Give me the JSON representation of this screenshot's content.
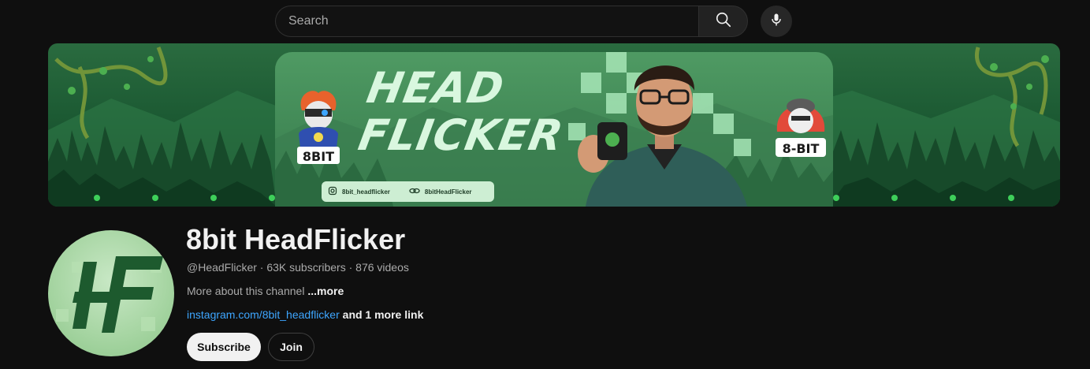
{
  "search": {
    "placeholder": "Search"
  },
  "icons": {
    "search": "search-icon",
    "mic": "microphone-icon",
    "instagram": "instagram-icon",
    "link": "link-icon"
  },
  "banner": {
    "title_line1": "HEAD",
    "title_line2": "FLICKER",
    "instagram_handle": "8bit_headflicker",
    "link_handle": "8bitHeadFlicker",
    "logo_left_text": "8BIT",
    "logo_right_text": "8-BIT"
  },
  "avatar": {
    "initials": "HF"
  },
  "channel": {
    "name": "8bit HeadFlicker",
    "handle": "@HeadFlicker",
    "subscribers": "63K subscribers",
    "videos": "876 videos",
    "meta_line": "@HeadFlicker · 63K subscribers · 876 videos",
    "about_text": "More about this channel ",
    "about_more": "...more",
    "link_text": "instagram.com/8bit_headflicker",
    "link_extra": " and 1 more link"
  },
  "buttons": {
    "subscribe": "Subscribe",
    "join": "Join"
  },
  "colors": {
    "background": "#0f0f0f",
    "link": "#3ea6ff",
    "banner_green": "#2a6b3f"
  }
}
